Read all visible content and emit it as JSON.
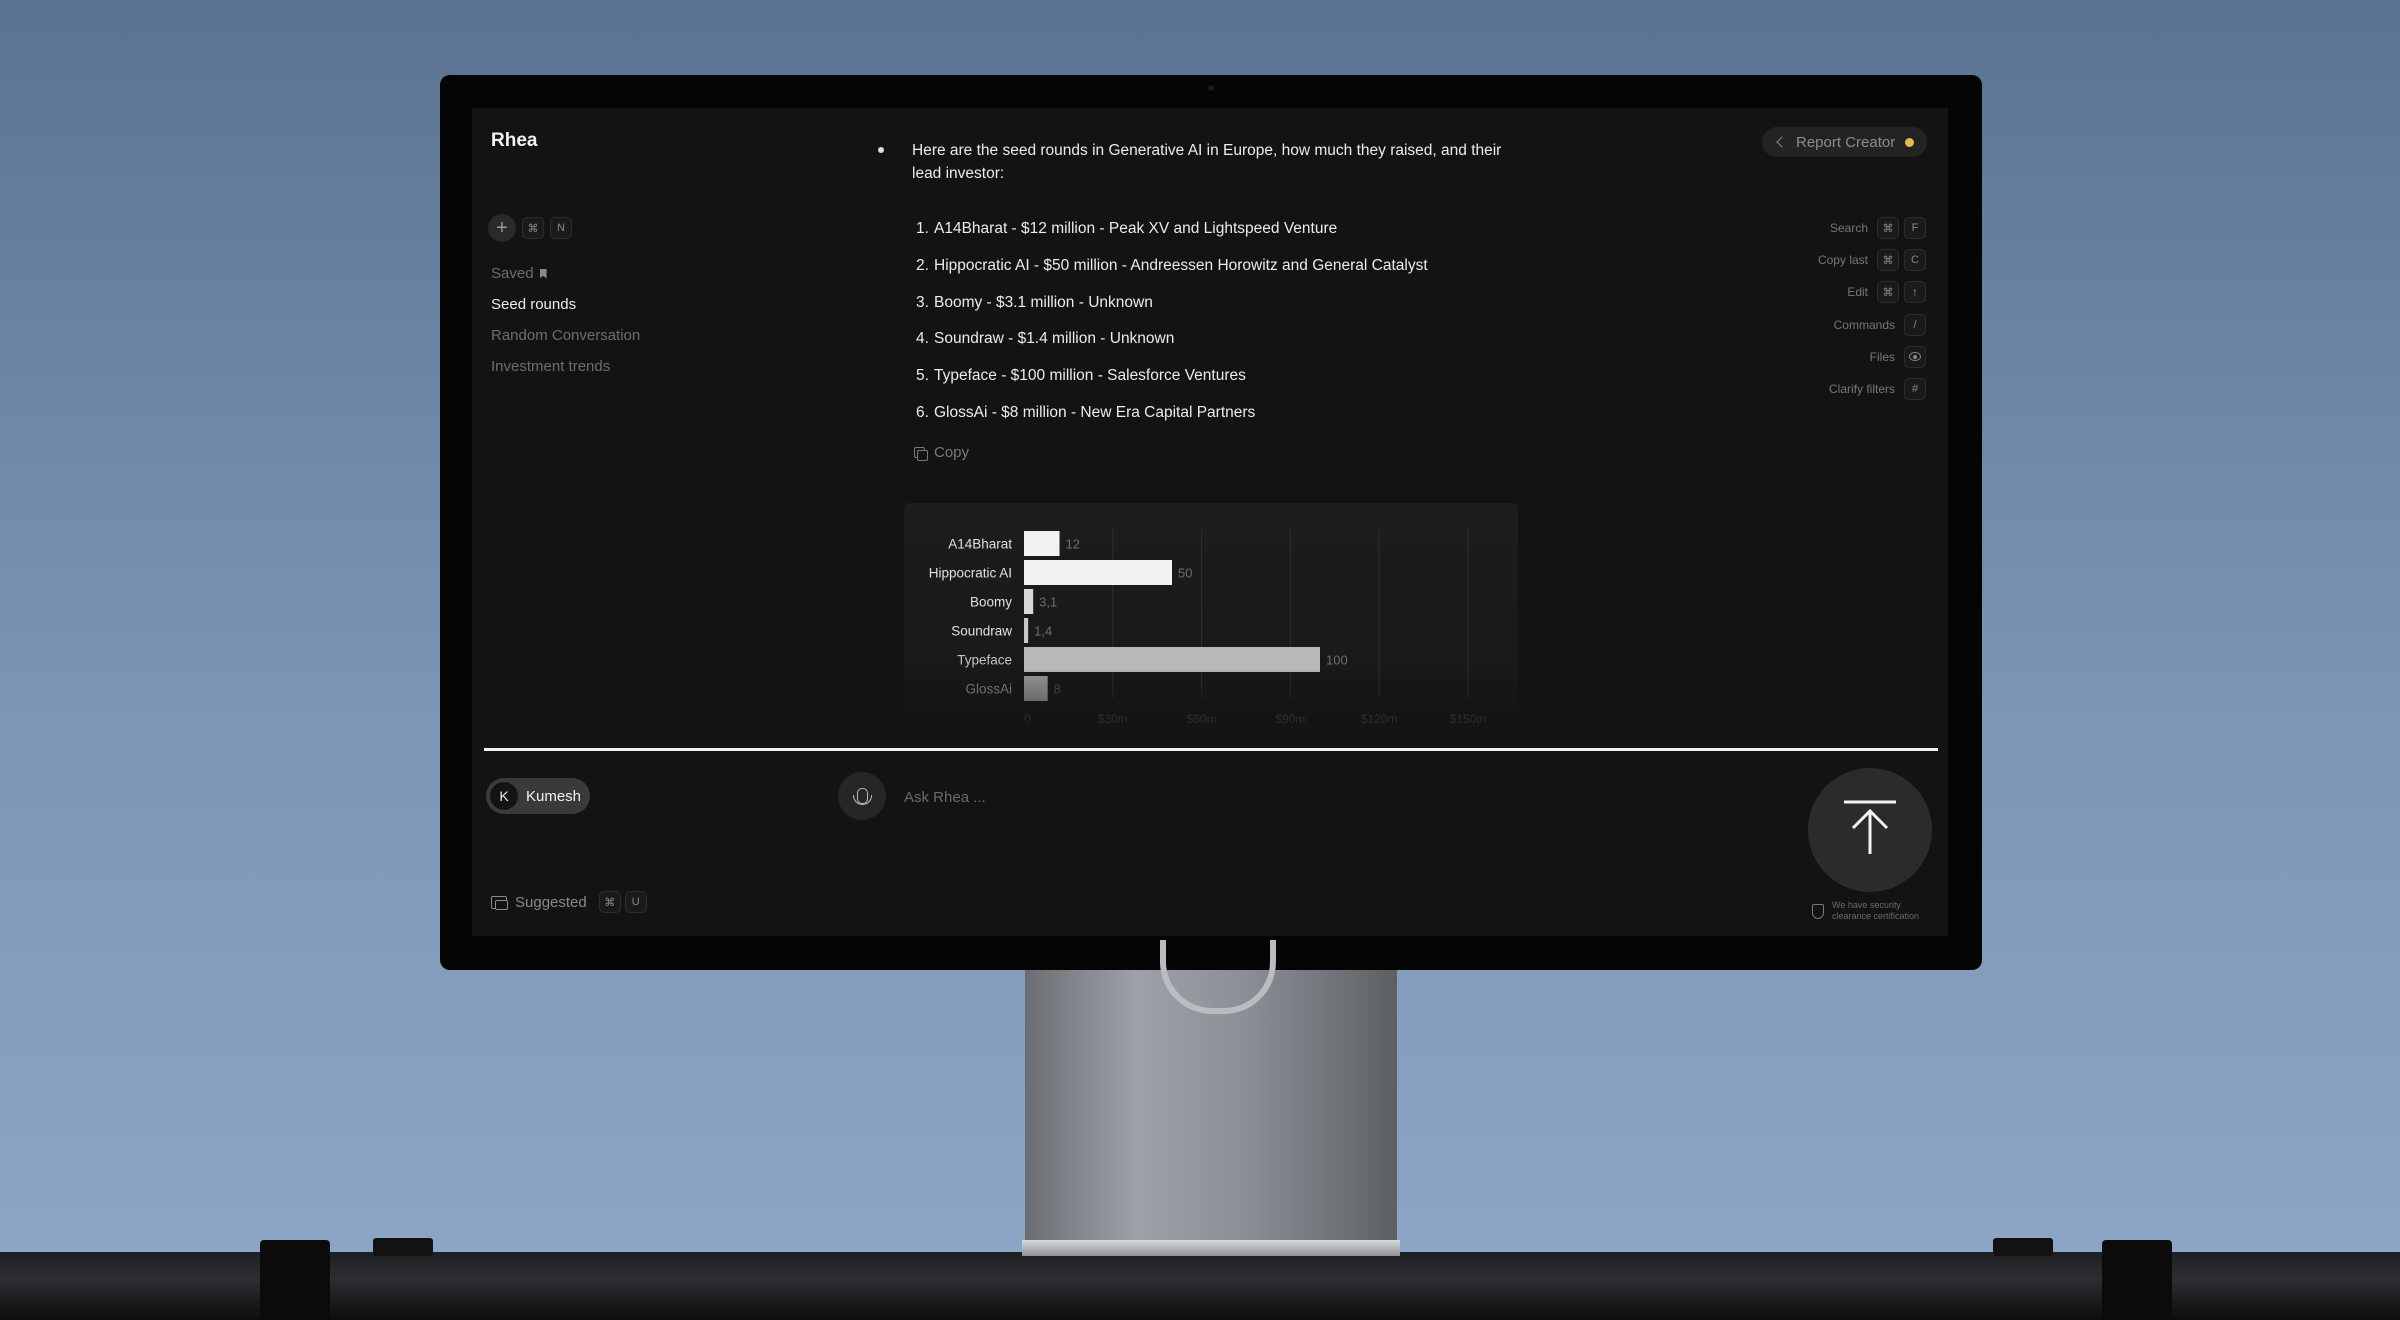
{
  "app": {
    "name": "Rhea"
  },
  "sidebar": {
    "new_shortcut": [
      "⌘",
      "N"
    ],
    "items": [
      {
        "label": "Saved",
        "active": false,
        "icon": "bookmark-icon"
      },
      {
        "label": "Seed rounds",
        "active": true
      },
      {
        "label": "Random Conversation",
        "active": false
      },
      {
        "label": "Investment trends",
        "active": false
      }
    ]
  },
  "reply": {
    "intro": "Here are the seed rounds in Generative AI in Europe, how much they raised, and their lead investor:",
    "items": [
      {
        "num": "1.",
        "text": "A14Bharat - $12 million - Peak XV and Lightspeed Venture"
      },
      {
        "num": "2.",
        "text": "Hippocratic AI - $50 million - Andreessen Horowitz and General Catalyst"
      },
      {
        "num": "3.",
        "text": "Boomy - $3.1 million - Unknown"
      },
      {
        "num": "4.",
        "text": "Soundraw - $1.4 million - Unknown"
      },
      {
        "num": "5.",
        "text": "Typeface - $100 million - Salesforce Ventures"
      },
      {
        "num": "6.",
        "text": "GlossAi - $8 million - New Era Capital Partners"
      }
    ],
    "copy_label": "Copy"
  },
  "chart_data": {
    "type": "bar",
    "orientation": "horizontal",
    "categories": [
      "A14Bharat",
      "Hippocratic AI",
      "Boomy",
      "Soundraw",
      "Typeface",
      "GlossAi"
    ],
    "values": [
      12,
      50,
      3.1,
      1.4,
      100,
      8
    ],
    "value_labels": [
      "12",
      "50",
      "3,1",
      "1,4",
      "100",
      "8"
    ],
    "xticks": [
      0,
      30,
      60,
      90,
      120,
      150
    ],
    "xtick_labels": [
      "0",
      "$30m",
      "$60m",
      "$90m",
      "$120m",
      "$150m"
    ],
    "xlim": [
      0,
      150
    ],
    "grid": true
  },
  "top_right": {
    "label": "Report Creator",
    "status_color": "#e5b84f"
  },
  "shortcuts": [
    {
      "label": "Search",
      "keys": [
        "⌘",
        "F"
      ]
    },
    {
      "label": "Copy last",
      "keys": [
        "⌘",
        "C"
      ]
    },
    {
      "label": "Edit",
      "keys": [
        "⌘",
        "↑"
      ]
    },
    {
      "label": "Commands",
      "keys": [
        "/"
      ]
    },
    {
      "label": "Files",
      "keys": [],
      "icon": "eye-icon"
    },
    {
      "label": "Clarify filters",
      "keys": [
        "#"
      ]
    }
  ],
  "user": {
    "initial": "K",
    "name": "Kumesh"
  },
  "input": {
    "placeholder": "Ask Rhea ..."
  },
  "suggested": {
    "label": "Suggested",
    "keys": [
      "⌘",
      "U"
    ]
  },
  "security": {
    "text": "We have security clearance certification"
  }
}
